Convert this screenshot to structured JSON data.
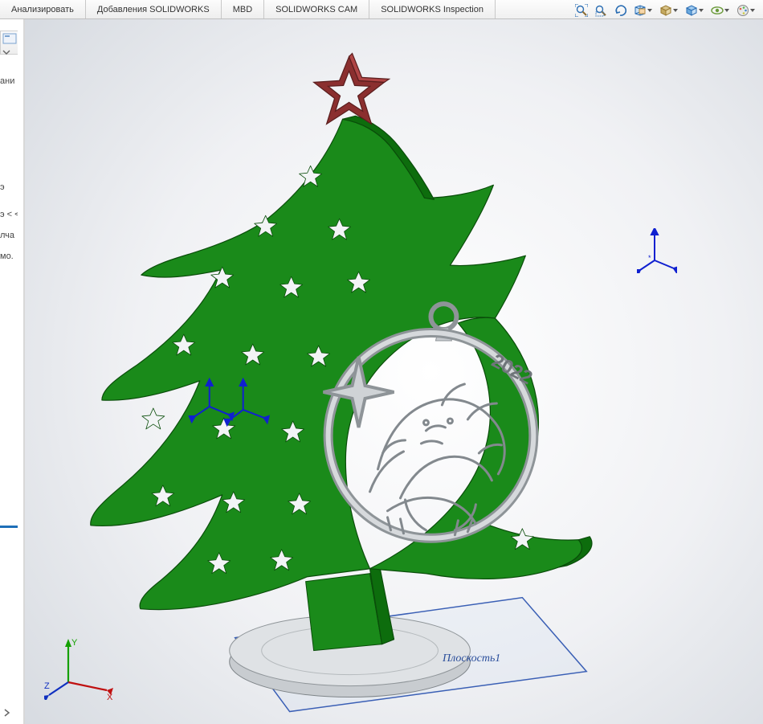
{
  "tabs": {
    "analyze": "Анализировать",
    "addins": "Добавления SOLIDWORKS",
    "mbd": "MBD",
    "cam": "SOLIDWORKS CAM",
    "inspection": "SOLIDWORKS Inspection"
  },
  "leftpanel": {
    "stub1": "ани",
    "cut1": "э",
    "cut2": "э < <",
    "cut3": "лча",
    "cut4": "мо."
  },
  "viewtools_icons": {
    "zoom_fit": "zoom-fit-icon",
    "zoom_area": "zoom-area-icon",
    "prev_view": "prev-view-icon",
    "section": "section-view-icon",
    "view_orient": "view-orientation-icon",
    "display_style": "display-style-icon",
    "hide_show": "hide-show-icon",
    "appearance": "appearance-icon",
    "scene": "scene-icon"
  },
  "triad": {
    "x": "X",
    "y": "Y",
    "z": "Z"
  },
  "plane_label": "Плоскость1",
  "model": {
    "ornament_year": "2022",
    "colors": {
      "tree": "#1a8a1a",
      "tree_shade": "#0d6d0d",
      "star": "#8b2f2f",
      "star_hi": "#b04545",
      "steel": "#bfc4c8",
      "steel_dk": "#8e9498",
      "plane_stroke": "#3a5fb5"
    }
  }
}
